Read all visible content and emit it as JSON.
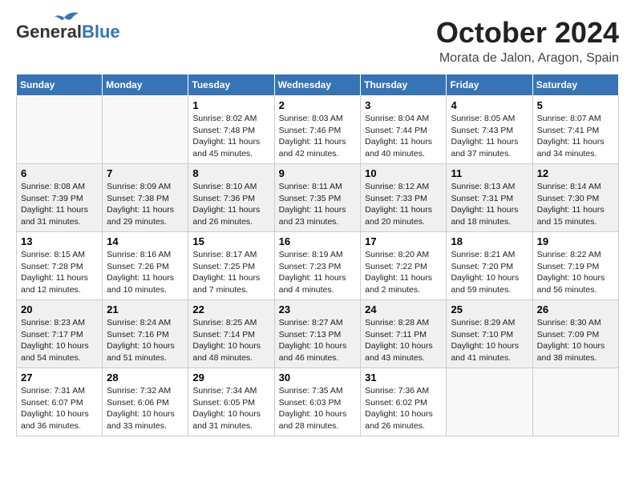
{
  "header": {
    "logo_line1": "General",
    "logo_line2": "Blue",
    "month": "October 2024",
    "location": "Morata de Jalon, Aragon, Spain"
  },
  "days_of_week": [
    "Sunday",
    "Monday",
    "Tuesday",
    "Wednesday",
    "Thursday",
    "Friday",
    "Saturday"
  ],
  "weeks": [
    [
      {
        "day": "",
        "detail": ""
      },
      {
        "day": "",
        "detail": ""
      },
      {
        "day": "1",
        "detail": "Sunrise: 8:02 AM\nSunset: 7:48 PM\nDaylight: 11 hours\nand 45 minutes."
      },
      {
        "day": "2",
        "detail": "Sunrise: 8:03 AM\nSunset: 7:46 PM\nDaylight: 11 hours\nand 42 minutes."
      },
      {
        "day": "3",
        "detail": "Sunrise: 8:04 AM\nSunset: 7:44 PM\nDaylight: 11 hours\nand 40 minutes."
      },
      {
        "day": "4",
        "detail": "Sunrise: 8:05 AM\nSunset: 7:43 PM\nDaylight: 11 hours\nand 37 minutes."
      },
      {
        "day": "5",
        "detail": "Sunrise: 8:07 AM\nSunset: 7:41 PM\nDaylight: 11 hours\nand 34 minutes."
      }
    ],
    [
      {
        "day": "6",
        "detail": "Sunrise: 8:08 AM\nSunset: 7:39 PM\nDaylight: 11 hours\nand 31 minutes."
      },
      {
        "day": "7",
        "detail": "Sunrise: 8:09 AM\nSunset: 7:38 PM\nDaylight: 11 hours\nand 29 minutes."
      },
      {
        "day": "8",
        "detail": "Sunrise: 8:10 AM\nSunset: 7:36 PM\nDaylight: 11 hours\nand 26 minutes."
      },
      {
        "day": "9",
        "detail": "Sunrise: 8:11 AM\nSunset: 7:35 PM\nDaylight: 11 hours\nand 23 minutes."
      },
      {
        "day": "10",
        "detail": "Sunrise: 8:12 AM\nSunset: 7:33 PM\nDaylight: 11 hours\nand 20 minutes."
      },
      {
        "day": "11",
        "detail": "Sunrise: 8:13 AM\nSunset: 7:31 PM\nDaylight: 11 hours\nand 18 minutes."
      },
      {
        "day": "12",
        "detail": "Sunrise: 8:14 AM\nSunset: 7:30 PM\nDaylight: 11 hours\nand 15 minutes."
      }
    ],
    [
      {
        "day": "13",
        "detail": "Sunrise: 8:15 AM\nSunset: 7:28 PM\nDaylight: 11 hours\nand 12 minutes."
      },
      {
        "day": "14",
        "detail": "Sunrise: 8:16 AM\nSunset: 7:26 PM\nDaylight: 11 hours\nand 10 minutes."
      },
      {
        "day": "15",
        "detail": "Sunrise: 8:17 AM\nSunset: 7:25 PM\nDaylight: 11 hours\nand 7 minutes."
      },
      {
        "day": "16",
        "detail": "Sunrise: 8:19 AM\nSunset: 7:23 PM\nDaylight: 11 hours\nand 4 minutes."
      },
      {
        "day": "17",
        "detail": "Sunrise: 8:20 AM\nSunset: 7:22 PM\nDaylight: 11 hours\nand 2 minutes."
      },
      {
        "day": "18",
        "detail": "Sunrise: 8:21 AM\nSunset: 7:20 PM\nDaylight: 10 hours\nand 59 minutes."
      },
      {
        "day": "19",
        "detail": "Sunrise: 8:22 AM\nSunset: 7:19 PM\nDaylight: 10 hours\nand 56 minutes."
      }
    ],
    [
      {
        "day": "20",
        "detail": "Sunrise: 8:23 AM\nSunset: 7:17 PM\nDaylight: 10 hours\nand 54 minutes."
      },
      {
        "day": "21",
        "detail": "Sunrise: 8:24 AM\nSunset: 7:16 PM\nDaylight: 10 hours\nand 51 minutes."
      },
      {
        "day": "22",
        "detail": "Sunrise: 8:25 AM\nSunset: 7:14 PM\nDaylight: 10 hours\nand 48 minutes."
      },
      {
        "day": "23",
        "detail": "Sunrise: 8:27 AM\nSunset: 7:13 PM\nDaylight: 10 hours\nand 46 minutes."
      },
      {
        "day": "24",
        "detail": "Sunrise: 8:28 AM\nSunset: 7:11 PM\nDaylight: 10 hours\nand 43 minutes."
      },
      {
        "day": "25",
        "detail": "Sunrise: 8:29 AM\nSunset: 7:10 PM\nDaylight: 10 hours\nand 41 minutes."
      },
      {
        "day": "26",
        "detail": "Sunrise: 8:30 AM\nSunset: 7:09 PM\nDaylight: 10 hours\nand 38 minutes."
      }
    ],
    [
      {
        "day": "27",
        "detail": "Sunrise: 7:31 AM\nSunset: 6:07 PM\nDaylight: 10 hours\nand 36 minutes."
      },
      {
        "day": "28",
        "detail": "Sunrise: 7:32 AM\nSunset: 6:06 PM\nDaylight: 10 hours\nand 33 minutes."
      },
      {
        "day": "29",
        "detail": "Sunrise: 7:34 AM\nSunset: 6:05 PM\nDaylight: 10 hours\nand 31 minutes."
      },
      {
        "day": "30",
        "detail": "Sunrise: 7:35 AM\nSunset: 6:03 PM\nDaylight: 10 hours\nand 28 minutes."
      },
      {
        "day": "31",
        "detail": "Sunrise: 7:36 AM\nSunset: 6:02 PM\nDaylight: 10 hours\nand 26 minutes."
      },
      {
        "day": "",
        "detail": ""
      },
      {
        "day": "",
        "detail": ""
      }
    ]
  ]
}
